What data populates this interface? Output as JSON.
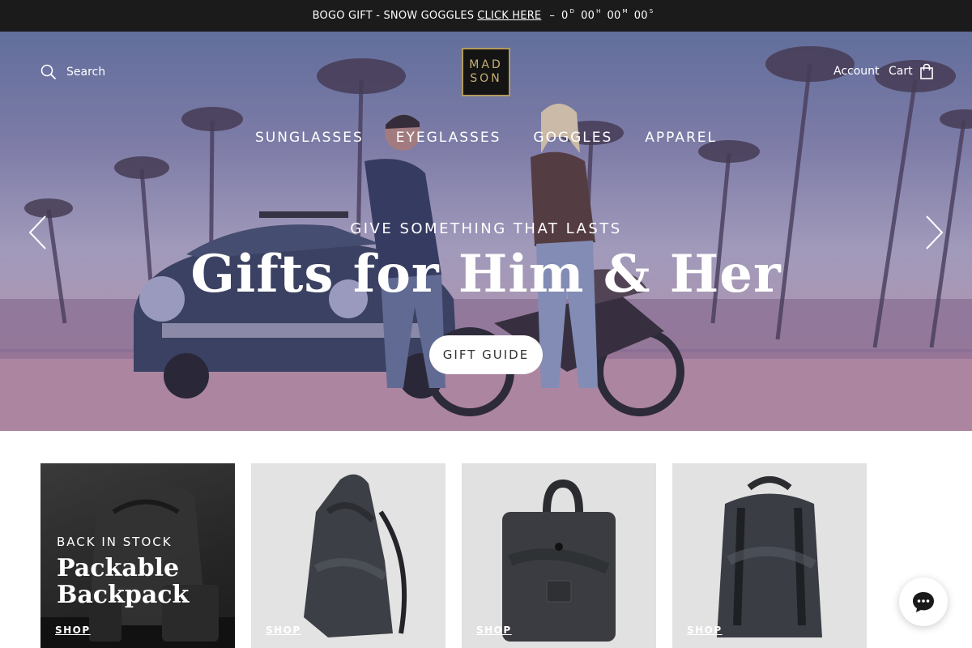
{
  "announcement": {
    "text": "BOGO GIFT - SNOW GOGGLES",
    "link": "CLICK HERE",
    "dash": "–",
    "countdown": [
      {
        "value": "0",
        "unit": "D"
      },
      {
        "value": "00",
        "unit": "H"
      },
      {
        "value": "00",
        "unit": "M"
      },
      {
        "value": "00",
        "unit": "S"
      }
    ]
  },
  "header": {
    "search_label": "Search",
    "logo_line1": "MAD",
    "logo_line2": "SON",
    "account_label": "Account",
    "cart_label": "Cart"
  },
  "nav": [
    "SUNGLASSES",
    "EYEGLASSES",
    "GOGGLES",
    "APPAREL"
  ],
  "hero": {
    "eyebrow": "GIVE SOMETHING THAT LASTS",
    "headline": "Gifts for Him & Her",
    "cta": "GIFT GUIDE"
  },
  "tiles": [
    {
      "eyebrow": "BACK IN STOCK",
      "title_line1": "Packable",
      "title_line2": "Backpack",
      "shop": "SHOP"
    },
    {
      "shop": "SHOP"
    },
    {
      "shop": "SHOP"
    },
    {
      "shop": "SHOP"
    }
  ],
  "icons": {
    "search": "search-icon",
    "cart": "shopping-bag-icon",
    "prev": "chevron-left-icon",
    "next": "chevron-right-icon",
    "chat": "chat-icon"
  }
}
